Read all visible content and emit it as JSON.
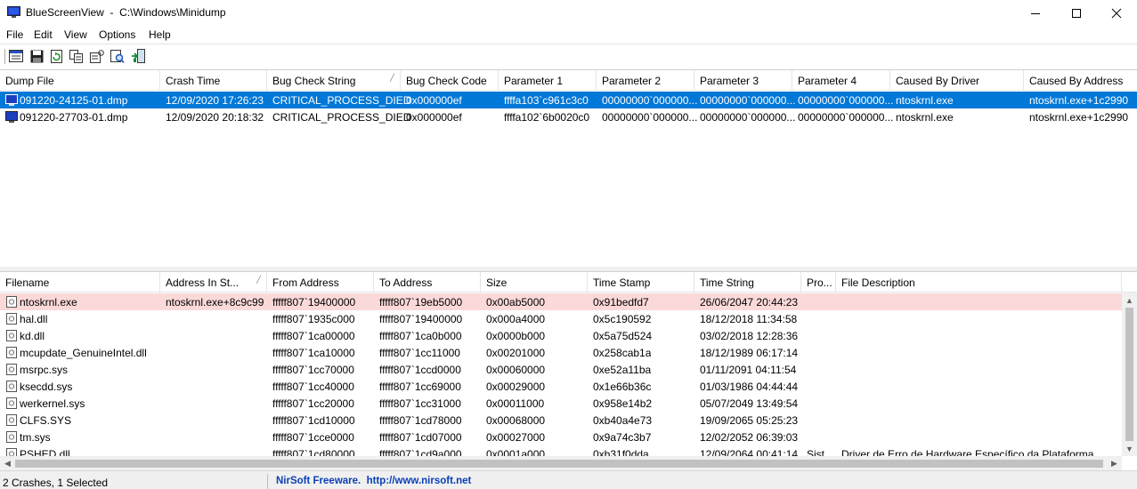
{
  "window": {
    "title": "BlueScreenView  -  C:\\Windows\\Minidump",
    "icon": "bluescreen-app-icon",
    "controls": [
      "minimize-icon",
      "maximize-icon",
      "close-icon"
    ]
  },
  "menu": [
    "File",
    "Edit",
    "View",
    "Options",
    "Help"
  ],
  "toolbar": [
    "html-report-icon",
    "save-icon",
    "refresh-icon",
    "copy-icon",
    "properties-icon",
    "find-icon",
    "exit-icon"
  ],
  "upper": {
    "columns": [
      "Dump File",
      "Crash Time",
      "Bug Check String",
      "Bug Check Code",
      "Parameter 1",
      "Parameter 2",
      "Parameter 3",
      "Parameter 4",
      "Caused By Driver",
      "Caused By Address"
    ],
    "sorted_column": "Bug Check String",
    "rows": [
      [
        "091220-24125-01.dmp",
        "12/09/2020 17:26:23",
        "CRITICAL_PROCESS_DIED",
        "0x000000ef",
        "ffffa103`c961c3c0",
        "00000000`000000...",
        "00000000`000000...",
        "00000000`000000...",
        "ntoskrnl.exe",
        "ntoskrnl.exe+1c2990"
      ],
      [
        "091220-27703-01.dmp",
        "12/09/2020 20:18:32",
        "CRITICAL_PROCESS_DIED",
        "0x000000ef",
        "ffffa102`6b0020c0",
        "00000000`000000...",
        "00000000`000000...",
        "00000000`000000...",
        "ntoskrnl.exe",
        "ntoskrnl.exe+1c2990"
      ]
    ]
  },
  "lower": {
    "columns": [
      "Filename",
      "Address In St...",
      "From Address",
      "To Address",
      "Size",
      "Time Stamp",
      "Time String",
      "Pro...",
      "File Description"
    ],
    "sorted_column": "Address In St...",
    "rows": [
      [
        "ntoskrnl.exe",
        "ntoskrnl.exe+8c9c99",
        "fffff807`19400000",
        "fffff807`19eb5000",
        "0x00ab5000",
        "0x91bedfd7",
        "26/06/2047 20:44:23",
        "",
        ""
      ],
      [
        "hal.dll",
        "",
        "fffff807`1935c000",
        "fffff807`19400000",
        "0x000a4000",
        "0x5c190592",
        "18/12/2018 11:34:58",
        "",
        ""
      ],
      [
        "kd.dll",
        "",
        "fffff807`1ca00000",
        "fffff807`1ca0b000",
        "0x0000b000",
        "0x5a75d524",
        "03/02/2018 12:28:36",
        "",
        ""
      ],
      [
        "mcupdate_GenuineIntel.dll",
        "",
        "fffff807`1ca10000",
        "fffff807`1cc11000",
        "0x00201000",
        "0x258cab1a",
        "18/12/1989 06:17:14",
        "",
        ""
      ],
      [
        "msrpc.sys",
        "",
        "fffff807`1cc70000",
        "fffff807`1ccd0000",
        "0x00060000",
        "0xe52a11ba",
        "01/11/2091 04:11:54",
        "",
        ""
      ],
      [
        "ksecdd.sys",
        "",
        "fffff807`1cc40000",
        "fffff807`1cc69000",
        "0x00029000",
        "0x1e66b36c",
        "01/03/1986 04:44:44",
        "",
        ""
      ],
      [
        "werkernel.sys",
        "",
        "fffff807`1cc20000",
        "fffff807`1cc31000",
        "0x00011000",
        "0x958e14b2",
        "05/07/2049 13:49:54",
        "",
        ""
      ],
      [
        "CLFS.SYS",
        "",
        "fffff807`1cd10000",
        "fffff807`1cd78000",
        "0x00068000",
        "0xb40a4e73",
        "19/09/2065 05:25:23",
        "",
        ""
      ],
      [
        "tm.sys",
        "",
        "fffff807`1cce0000",
        "fffff807`1cd07000",
        "0x00027000",
        "0x9a74c3b7",
        "12/02/2052 06:39:03",
        "",
        ""
      ],
      [
        "PSHED.dll",
        "",
        "fffff807`1cd80000",
        "fffff807`1cd9a000",
        "0x0001a000",
        "0xb31f0dda",
        "12/09/2064 00:41:14",
        "Sist...",
        "Driver de Erro de Hardware Específico da Plataforma"
      ]
    ]
  },
  "status": {
    "summary": "2 Crashes, 1 Selected",
    "link": "NirSoft Freeware.  http://www.nirsoft.net"
  },
  "colors": {
    "selection_blue": "#0078d7",
    "highlight_pink": "#fbd9d9",
    "link_blue": "#0a3fb5"
  }
}
